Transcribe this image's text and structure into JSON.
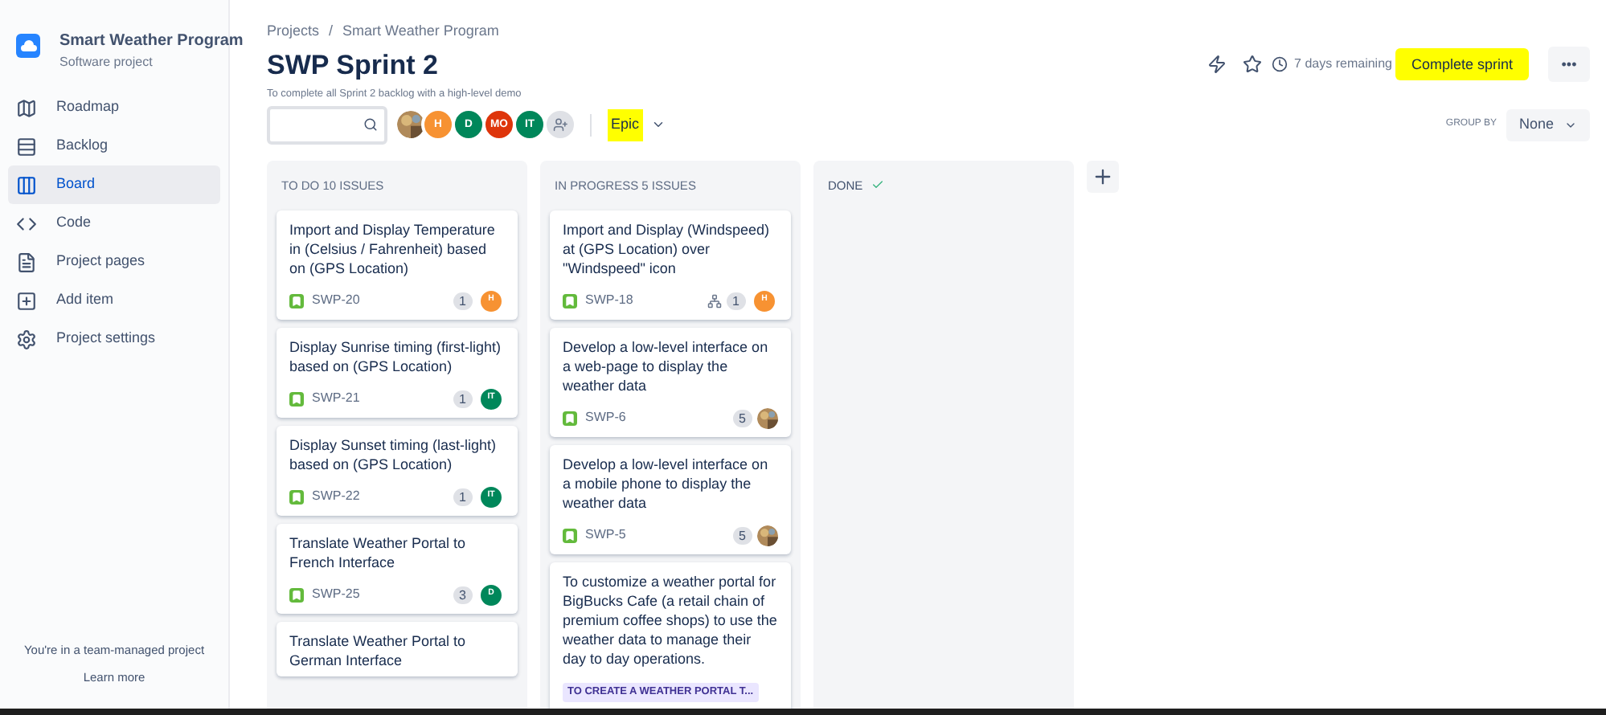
{
  "project": {
    "name": "Smart Weather Program",
    "type": "Software project"
  },
  "sidebar": {
    "items": [
      {
        "label": "Roadmap",
        "selected": false
      },
      {
        "label": "Backlog",
        "selected": false
      },
      {
        "label": "Board",
        "selected": true
      },
      {
        "label": "Code",
        "selected": false
      },
      {
        "label": "Project pages",
        "selected": false
      },
      {
        "label": "Add item",
        "selected": false
      },
      {
        "label": "Project settings",
        "selected": false
      }
    ],
    "footer": "You're in a team-managed project",
    "link": "Learn more"
  },
  "breadcrumbs": {
    "items": [
      "Projects",
      "Smart Weather Program"
    ],
    "separator": "/"
  },
  "title": "SWP Sprint 2",
  "goal": "To complete all Sprint 2 backlog with a high-level demo",
  "remaining": "7 days remaining",
  "complete_button": {
    "label": "Complete sprint",
    "highlighted": true
  },
  "more_button": "•••",
  "avatars": [
    {
      "kind": "photo"
    },
    {
      "kind": "initials",
      "text": "H",
      "color": "#f79232"
    },
    {
      "kind": "initials",
      "text": "D",
      "color": "#00875a"
    },
    {
      "kind": "initials",
      "text": "MO",
      "color": "#de350b"
    },
    {
      "kind": "initials",
      "text": "IT",
      "color": "#00875a"
    },
    {
      "kind": "add"
    }
  ],
  "epic_filter": {
    "label": "Epic",
    "highlighted": true
  },
  "group_by": {
    "label": "GROUP BY",
    "value": "None"
  },
  "columns": [
    {
      "title": "TO DO 10 ISSUES",
      "done": false,
      "cards": [
        {
          "summary": "Import and Display Temperature in (Celsius / Fahrenheit) based on (GPS Location)",
          "key": "SWP-20",
          "points": "1",
          "assignee": {
            "kind": "initials",
            "text": "H",
            "color": "#f79232"
          }
        },
        {
          "summary": "Display Sunrise timing (first-light) based on (GPS Location)",
          "key": "SWP-21",
          "points": "1",
          "assignee": {
            "kind": "initials",
            "text": "IT",
            "color": "#00875a"
          }
        },
        {
          "summary": "Display Sunset timing (last-light) based on (GPS Location)",
          "key": "SWP-22",
          "points": "1",
          "assignee": {
            "kind": "initials",
            "text": "IT",
            "color": "#00875a"
          }
        },
        {
          "summary": "Translate Weather Portal to French Interface",
          "key": "SWP-25",
          "points": "3",
          "assignee": {
            "kind": "initials",
            "text": "D",
            "color": "#00875a"
          }
        },
        {
          "summary": "Translate Weather Portal to German Interface"
        }
      ]
    },
    {
      "title": "IN PROGRESS 5 ISSUES",
      "done": false,
      "cards": [
        {
          "summary": "Import and Display (Windspeed) at (GPS Location) over \"Windspeed\" icon",
          "key": "SWP-18",
          "subtasks": true,
          "points": "1",
          "assignee": {
            "kind": "initials",
            "text": "H",
            "color": "#f79232"
          }
        },
        {
          "summary": "Develop a low-level interface on a web-page to display the weather data",
          "key": "SWP-6",
          "points": "5",
          "assignee": {
            "kind": "photo"
          }
        },
        {
          "summary": "Develop a low-level interface on a mobile phone to display the weather data",
          "key": "SWP-5",
          "points": "5",
          "assignee": {
            "kind": "photo"
          }
        },
        {
          "summary": "To customize a weather portal for BigBucks Cafe (a retail chain of premium coffee shops) to use the weather data to manage their day to day operations.",
          "epic": "TO CREATE A WEATHER PORTAL T..."
        }
      ]
    },
    {
      "title": "DONE",
      "done": true
    }
  ]
}
